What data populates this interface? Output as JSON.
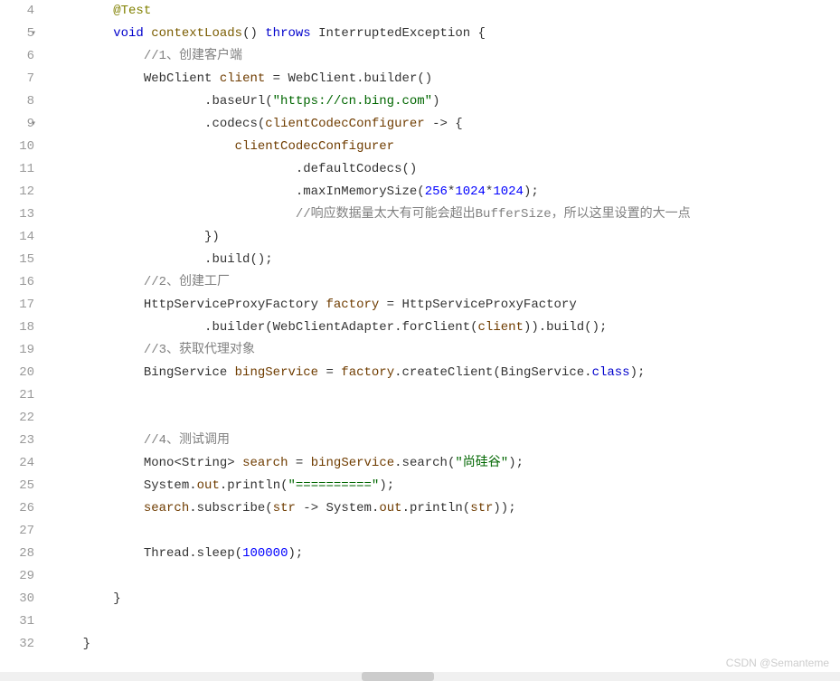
{
  "lines": [
    {
      "num": "4",
      "fold": false,
      "indent": "        ",
      "segments": [
        {
          "t": "@Test",
          "c": "annotation"
        }
      ]
    },
    {
      "num": "5",
      "fold": true,
      "indent": "        ",
      "segments": [
        {
          "t": "void",
          "c": "kw"
        },
        {
          "t": " ",
          "c": ""
        },
        {
          "t": "contextLoads",
          "c": "method"
        },
        {
          "t": "() ",
          "c": ""
        },
        {
          "t": "throws",
          "c": "kw"
        },
        {
          "t": " ",
          "c": ""
        },
        {
          "t": "InterruptedException",
          "c": "type"
        },
        {
          "t": " {",
          "c": ""
        }
      ]
    },
    {
      "num": "6",
      "fold": false,
      "indent": "            ",
      "segments": [
        {
          "t": "//1、创建客户端",
          "c": "comment"
        }
      ]
    },
    {
      "num": "7",
      "fold": false,
      "indent": "            ",
      "segments": [
        {
          "t": "WebClient",
          "c": "type"
        },
        {
          "t": " ",
          "c": ""
        },
        {
          "t": "client",
          "c": "var"
        },
        {
          "t": " = ",
          "c": ""
        },
        {
          "t": "WebClient",
          "c": "type"
        },
        {
          "t": ".",
          "c": ""
        },
        {
          "t": "builder",
          "c": "ident"
        },
        {
          "t": "()",
          "c": ""
        }
      ]
    },
    {
      "num": "8",
      "fold": false,
      "indent": "                    ",
      "segments": [
        {
          "t": ".",
          "c": ""
        },
        {
          "t": "baseUrl",
          "c": "ident"
        },
        {
          "t": "(",
          "c": ""
        },
        {
          "t": "\"https://cn.bing.com\"",
          "c": "string"
        },
        {
          "t": ")",
          "c": ""
        }
      ]
    },
    {
      "num": "9",
      "fold": true,
      "indent": "                    ",
      "segments": [
        {
          "t": ".",
          "c": ""
        },
        {
          "t": "codecs",
          "c": "ident"
        },
        {
          "t": "(",
          "c": ""
        },
        {
          "t": "clientCodecConfigurer",
          "c": "var"
        },
        {
          "t": " -> {",
          "c": ""
        }
      ]
    },
    {
      "num": "10",
      "fold": false,
      "indent": "                        ",
      "segments": [
        {
          "t": "clientCodecConfigurer",
          "c": "var"
        }
      ]
    },
    {
      "num": "11",
      "fold": false,
      "indent": "                                ",
      "segments": [
        {
          "t": ".",
          "c": ""
        },
        {
          "t": "defaultCodecs",
          "c": "ident"
        },
        {
          "t": "()",
          "c": ""
        }
      ]
    },
    {
      "num": "12",
      "fold": false,
      "indent": "                                ",
      "segments": [
        {
          "t": ".",
          "c": ""
        },
        {
          "t": "maxInMemorySize",
          "c": "ident"
        },
        {
          "t": "(",
          "c": ""
        },
        {
          "t": "256",
          "c": "number"
        },
        {
          "t": "*",
          "c": ""
        },
        {
          "t": "1024",
          "c": "number"
        },
        {
          "t": "*",
          "c": ""
        },
        {
          "t": "1024",
          "c": "number"
        },
        {
          "t": ");",
          "c": ""
        }
      ]
    },
    {
      "num": "13",
      "fold": false,
      "indent": "                                ",
      "segments": [
        {
          "t": "//响应数据量太大有可能会超出BufferSize，所以这里设置的大一点",
          "c": "comment"
        }
      ]
    },
    {
      "num": "14",
      "fold": false,
      "indent": "                    ",
      "segments": [
        {
          "t": "})",
          "c": ""
        }
      ]
    },
    {
      "num": "15",
      "fold": false,
      "indent": "                    ",
      "segments": [
        {
          "t": ".",
          "c": ""
        },
        {
          "t": "build",
          "c": "ident"
        },
        {
          "t": "();",
          "c": ""
        }
      ]
    },
    {
      "num": "16",
      "fold": false,
      "indent": "            ",
      "segments": [
        {
          "t": "//2、创建工厂",
          "c": "comment"
        }
      ]
    },
    {
      "num": "17",
      "fold": false,
      "indent": "            ",
      "segments": [
        {
          "t": "HttpServiceProxyFactory",
          "c": "type"
        },
        {
          "t": " ",
          "c": ""
        },
        {
          "t": "factory",
          "c": "var"
        },
        {
          "t": " = ",
          "c": ""
        },
        {
          "t": "HttpServiceProxyFactory",
          "c": "type"
        }
      ]
    },
    {
      "num": "18",
      "fold": false,
      "indent": "                    ",
      "segments": [
        {
          "t": ".",
          "c": ""
        },
        {
          "t": "builder",
          "c": "ident"
        },
        {
          "t": "(",
          "c": ""
        },
        {
          "t": "WebClientAdapter",
          "c": "type"
        },
        {
          "t": ".",
          "c": ""
        },
        {
          "t": "forClient",
          "c": "ident"
        },
        {
          "t": "(",
          "c": ""
        },
        {
          "t": "client",
          "c": "var"
        },
        {
          "t": ")).",
          "c": ""
        },
        {
          "t": "build",
          "c": "ident"
        },
        {
          "t": "();",
          "c": ""
        }
      ]
    },
    {
      "num": "19",
      "fold": false,
      "indent": "            ",
      "segments": [
        {
          "t": "//3、获取代理对象",
          "c": "comment"
        }
      ]
    },
    {
      "num": "20",
      "fold": false,
      "indent": "            ",
      "segments": [
        {
          "t": "BingService",
          "c": "type"
        },
        {
          "t": " ",
          "c": ""
        },
        {
          "t": "bingService",
          "c": "var"
        },
        {
          "t": " = ",
          "c": ""
        },
        {
          "t": "factory",
          "c": "var"
        },
        {
          "t": ".",
          "c": ""
        },
        {
          "t": "createClient",
          "c": "ident"
        },
        {
          "t": "(",
          "c": ""
        },
        {
          "t": "BingService",
          "c": "type"
        },
        {
          "t": ".",
          "c": ""
        },
        {
          "t": "class",
          "c": "kw"
        },
        {
          "t": ");",
          "c": ""
        }
      ]
    },
    {
      "num": "21",
      "fold": false,
      "indent": "",
      "segments": []
    },
    {
      "num": "22",
      "fold": false,
      "indent": "",
      "segments": []
    },
    {
      "num": "23",
      "fold": false,
      "indent": "            ",
      "segments": [
        {
          "t": "//4、测试调用",
          "c": "comment"
        }
      ]
    },
    {
      "num": "24",
      "fold": false,
      "indent": "            ",
      "segments": [
        {
          "t": "Mono",
          "c": "type"
        },
        {
          "t": "<",
          "c": ""
        },
        {
          "t": "String",
          "c": "type"
        },
        {
          "t": "> ",
          "c": ""
        },
        {
          "t": "search",
          "c": "var"
        },
        {
          "t": " = ",
          "c": ""
        },
        {
          "t": "bingService",
          "c": "var"
        },
        {
          "t": ".",
          "c": ""
        },
        {
          "t": "search",
          "c": "ident"
        },
        {
          "t": "(",
          "c": ""
        },
        {
          "t": "\"尚硅谷\"",
          "c": "string"
        },
        {
          "t": ");",
          "c": ""
        }
      ]
    },
    {
      "num": "25",
      "fold": false,
      "indent": "            ",
      "segments": [
        {
          "t": "System",
          "c": "type"
        },
        {
          "t": ".",
          "c": ""
        },
        {
          "t": "out",
          "c": "var"
        },
        {
          "t": ".",
          "c": ""
        },
        {
          "t": "println",
          "c": "ident"
        },
        {
          "t": "(",
          "c": ""
        },
        {
          "t": "\"==========\"",
          "c": "string"
        },
        {
          "t": ");",
          "c": ""
        }
      ]
    },
    {
      "num": "26",
      "fold": false,
      "indent": "            ",
      "segments": [
        {
          "t": "search",
          "c": "var"
        },
        {
          "t": ".",
          "c": ""
        },
        {
          "t": "subscribe",
          "c": "ident"
        },
        {
          "t": "(",
          "c": ""
        },
        {
          "t": "str",
          "c": "var"
        },
        {
          "t": " -> ",
          "c": ""
        },
        {
          "t": "System",
          "c": "type"
        },
        {
          "t": ".",
          "c": ""
        },
        {
          "t": "out",
          "c": "var"
        },
        {
          "t": ".",
          "c": ""
        },
        {
          "t": "println",
          "c": "ident"
        },
        {
          "t": "(",
          "c": ""
        },
        {
          "t": "str",
          "c": "var"
        },
        {
          "t": "));",
          "c": ""
        }
      ]
    },
    {
      "num": "27",
      "fold": false,
      "indent": "",
      "segments": []
    },
    {
      "num": "28",
      "fold": false,
      "indent": "            ",
      "segments": [
        {
          "t": "Thread",
          "c": "type"
        },
        {
          "t": ".",
          "c": ""
        },
        {
          "t": "sleep",
          "c": "ident"
        },
        {
          "t": "(",
          "c": ""
        },
        {
          "t": "100000",
          "c": "number"
        },
        {
          "t": ");",
          "c": ""
        }
      ]
    },
    {
      "num": "29",
      "fold": false,
      "indent": "",
      "segments": []
    },
    {
      "num": "30",
      "fold": false,
      "indent": "        ",
      "segments": [
        {
          "t": "}",
          "c": ""
        }
      ]
    },
    {
      "num": "31",
      "fold": false,
      "indent": "",
      "segments": []
    },
    {
      "num": "32",
      "fold": false,
      "indent": "    ",
      "segments": [
        {
          "t": "}",
          "c": ""
        }
      ]
    }
  ],
  "watermark": "CSDN @Semanteme",
  "fold_glyph": "▾"
}
